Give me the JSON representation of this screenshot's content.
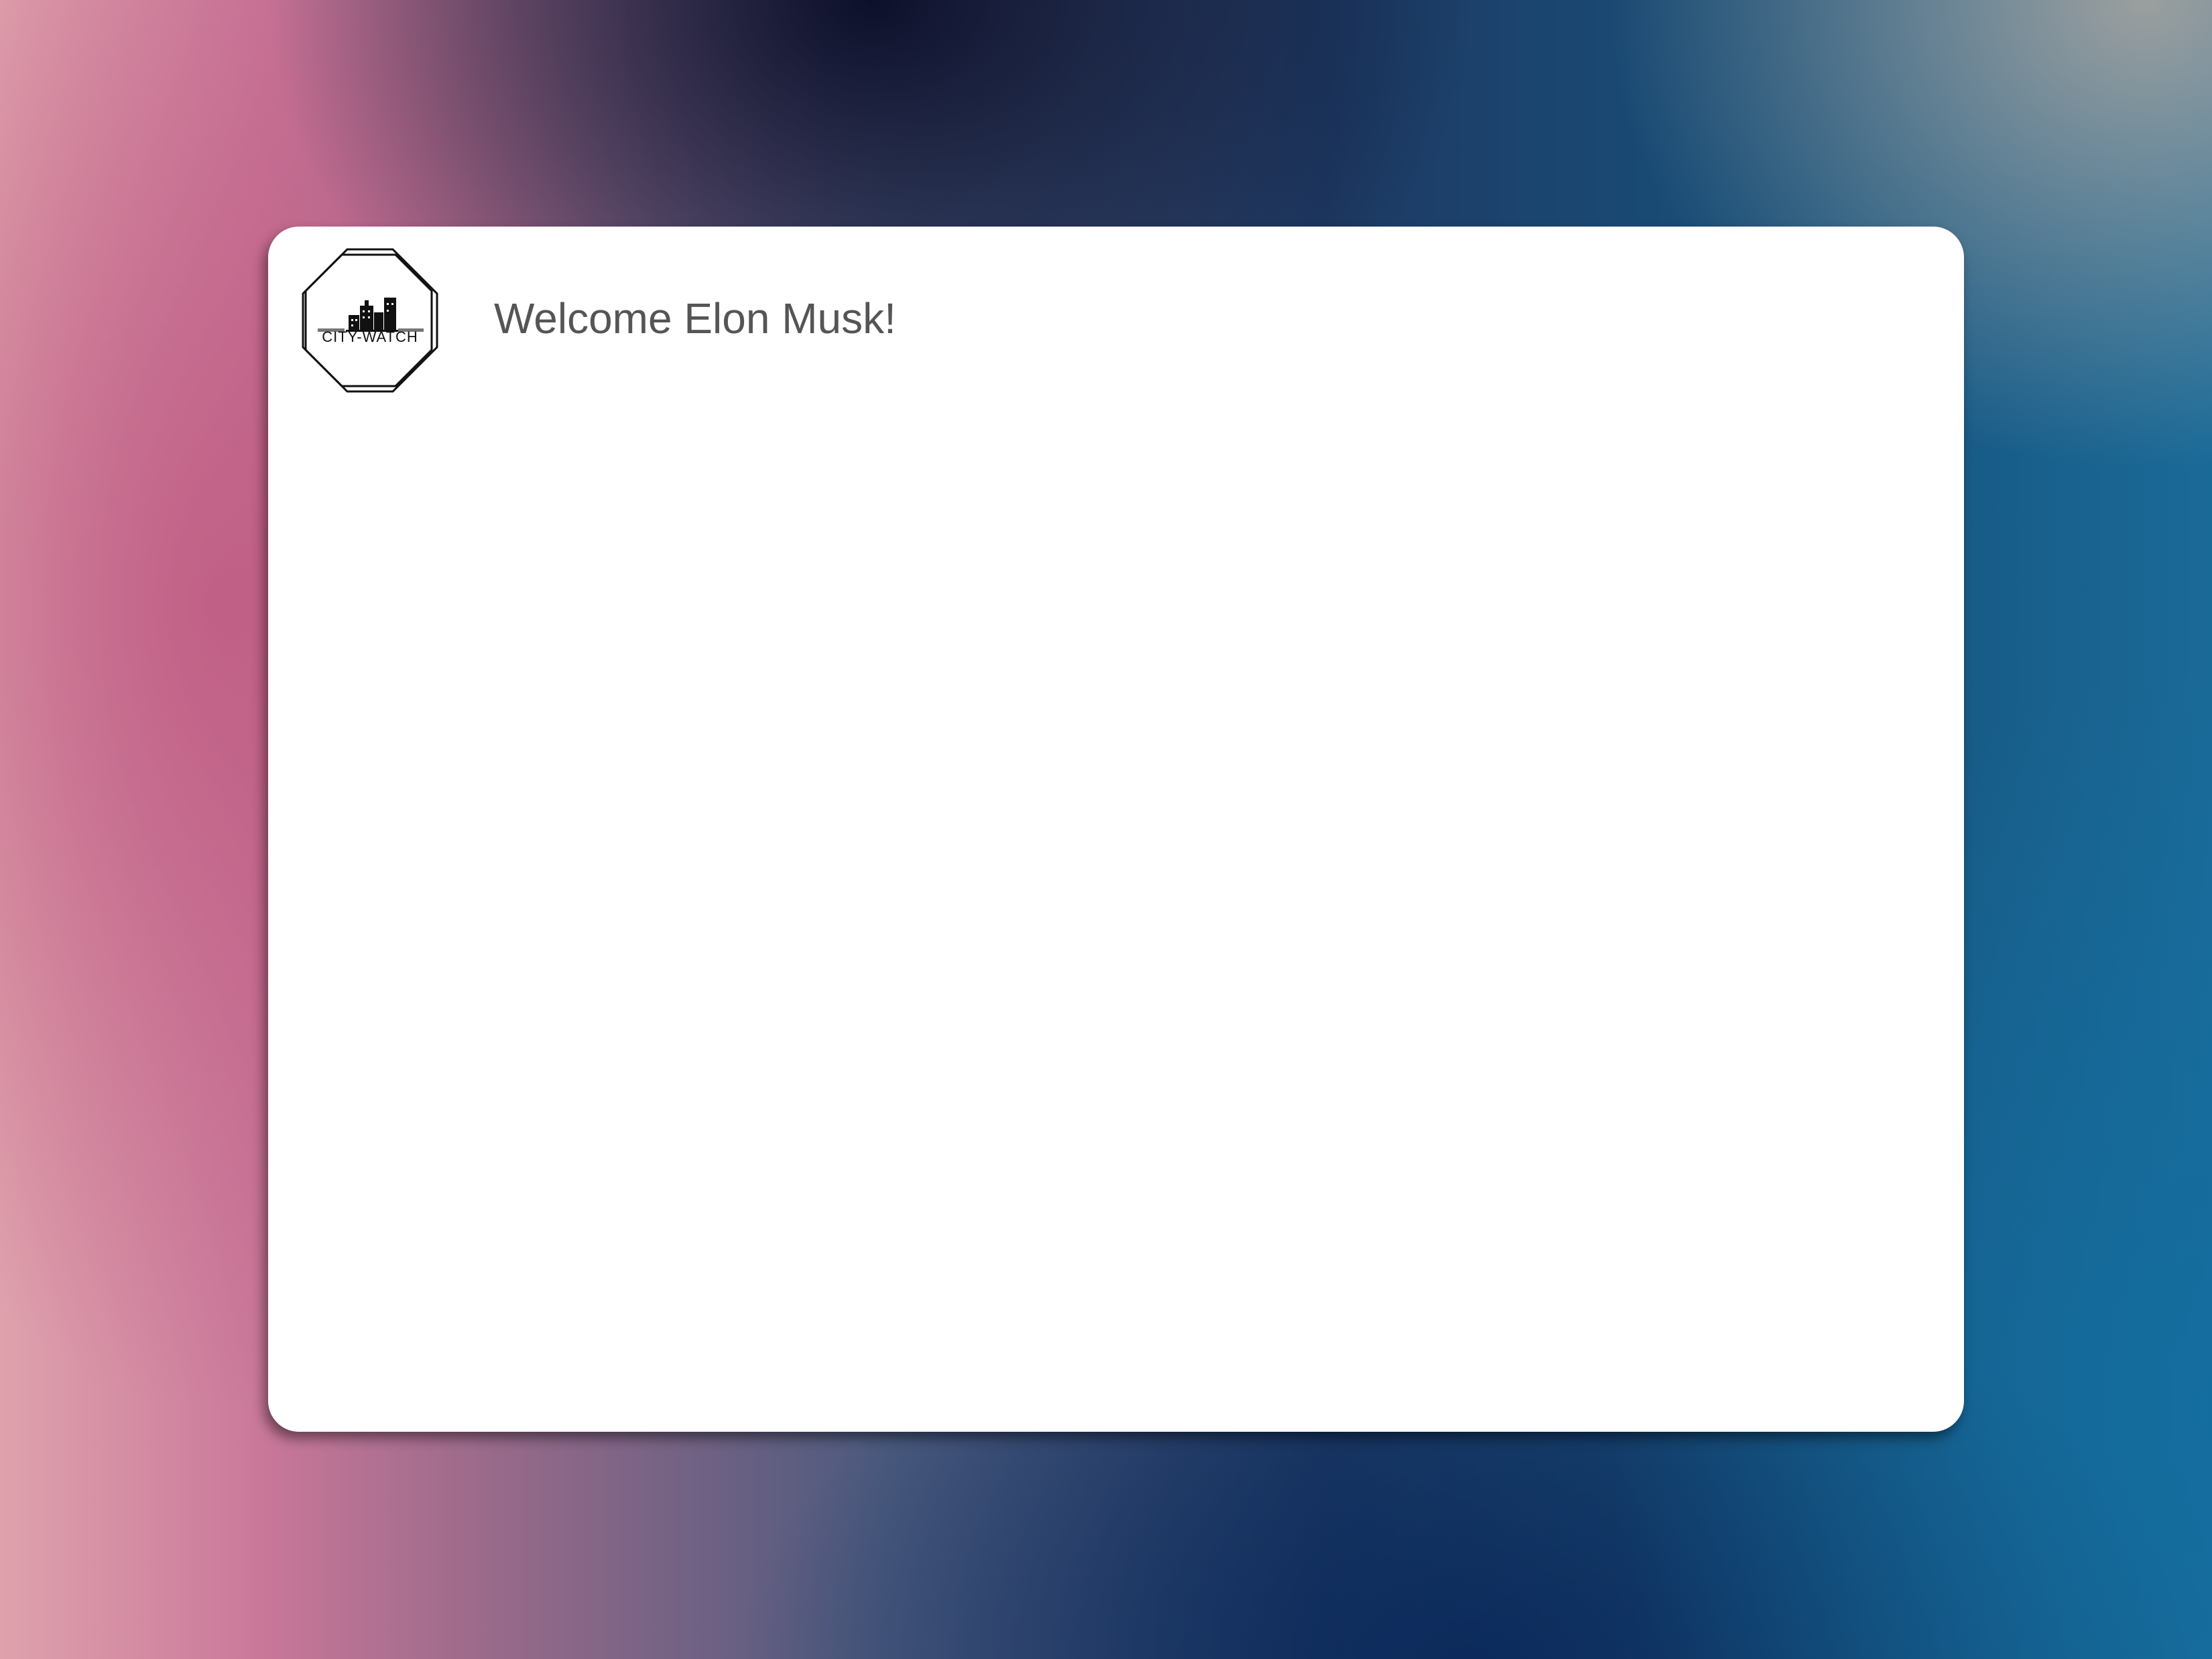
{
  "header": {
    "logo_text": "CITY-WATCH",
    "welcome_text": "Welcome Elon Musk!"
  },
  "colors": {
    "card_background": "#ffffff",
    "welcome_text": "#555555"
  },
  "icons": {
    "logo": "city-skyline-octagon-logo"
  }
}
